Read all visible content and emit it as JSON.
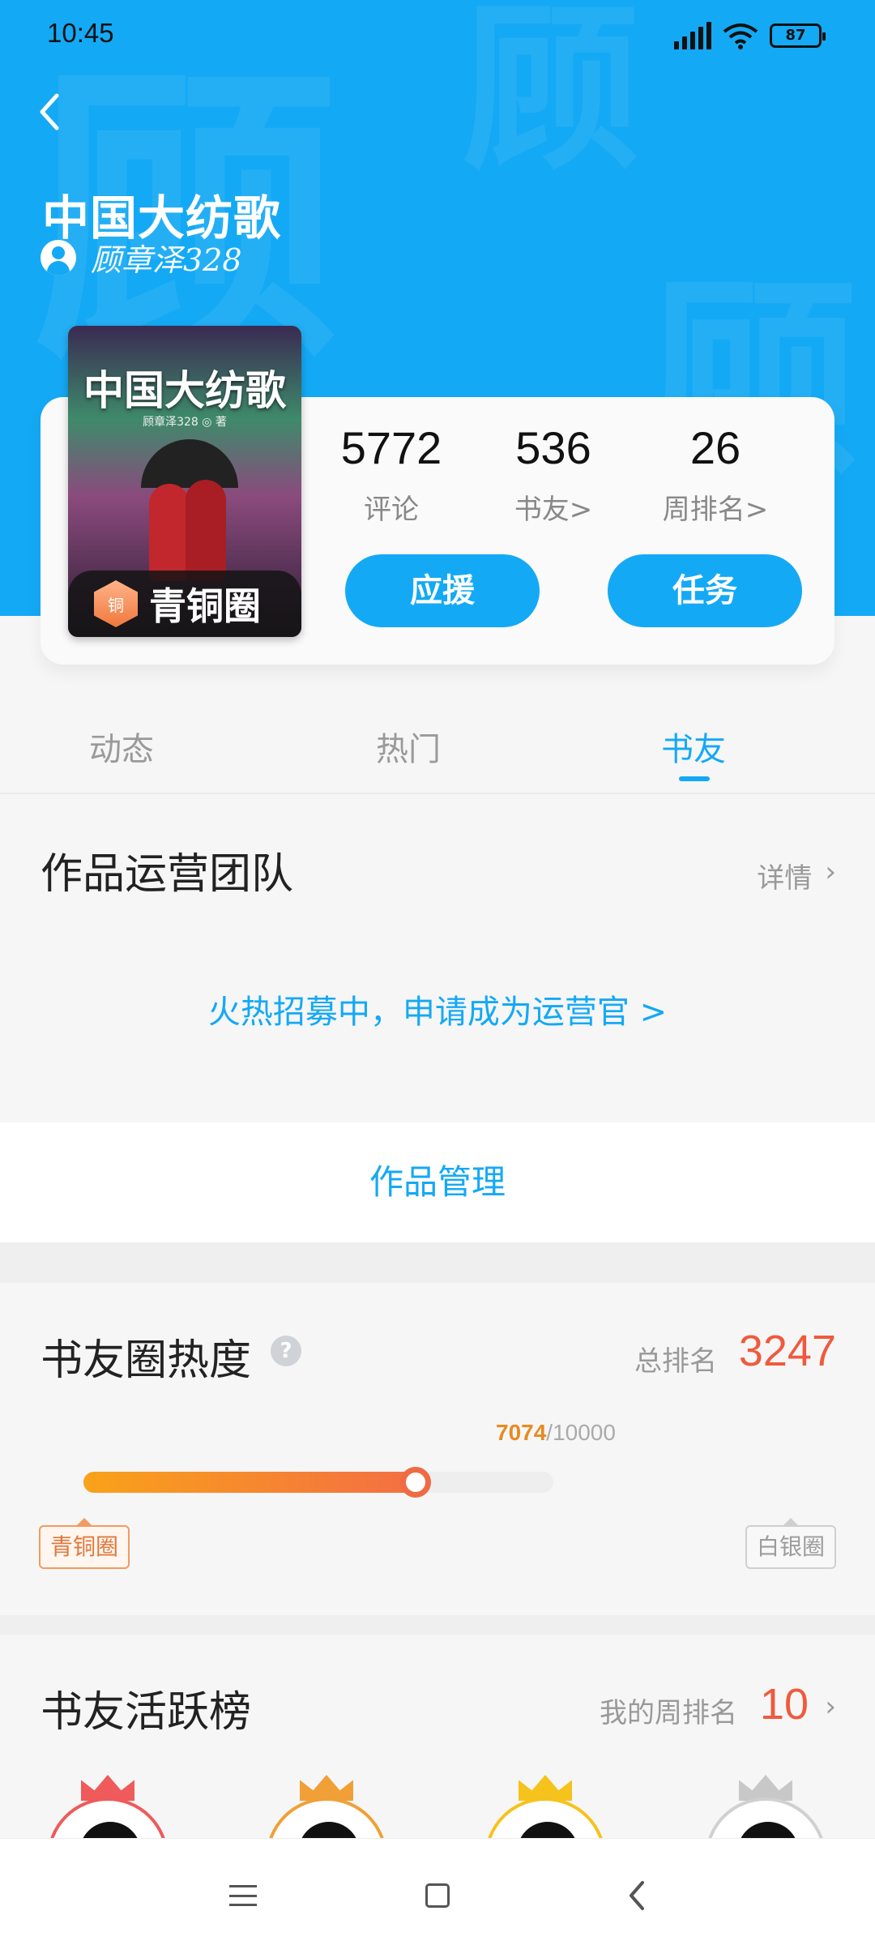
{
  "status_bar": {
    "time": "10:45",
    "battery": "87"
  },
  "header": {
    "title": "中国大纺歌",
    "author": "顾章泽328",
    "cover_title": "中国大纺歌",
    "cover_subtitle": "顾章泽328 ◎ 著",
    "badge": "青铜圈",
    "badge_icon_text": "铜"
  },
  "stats": [
    {
      "value": "5772",
      "label": "评论"
    },
    {
      "value": "536",
      "label": "书友>"
    },
    {
      "value": "26",
      "label": "周排名>"
    }
  ],
  "actions": {
    "support": "应援",
    "task": "任务"
  },
  "tabs": [
    {
      "label": "动态"
    },
    {
      "label": "热门"
    },
    {
      "label": "书友",
      "active": true
    }
  ],
  "team": {
    "title": "作品运营团队",
    "detail": "详情",
    "recruit": "火热招募中，申请成为运营官 >"
  },
  "manage": {
    "label": "作品管理"
  },
  "heat": {
    "title": "书友圈热度",
    "help": "?",
    "rank_label": "总排名",
    "rank_value": "3247",
    "progress_current": "7074",
    "progress_total": "/10000",
    "progress_fraction": 0.7074,
    "level_from": "青铜圈",
    "level_to": "白银圈"
  },
  "active_board": {
    "title": "书友活跃榜",
    "my_rank_label": "我的周排名",
    "my_rank_value": "10",
    "avatars": [
      {
        "crown_color": "#ef5a5a",
        "ring_color": "#ef5a5a"
      },
      {
        "crown_color": "#f0a036",
        "ring_color": "#f0a036"
      },
      {
        "crown_color": "#f6c21c",
        "ring_color": "#f6c21c"
      },
      {
        "crown_color": "#c8c8c8",
        "ring_color": "#d0d0d0"
      }
    ]
  },
  "colors": {
    "accent": "#14a9f5",
    "rank_red": "#ef5a3e",
    "progress_start": "#f9a21a",
    "progress_end": "#f36f43"
  },
  "icons": {
    "back": "chevron-left-icon",
    "nav": [
      "menu-icon",
      "home-icon",
      "back-icon"
    ]
  }
}
